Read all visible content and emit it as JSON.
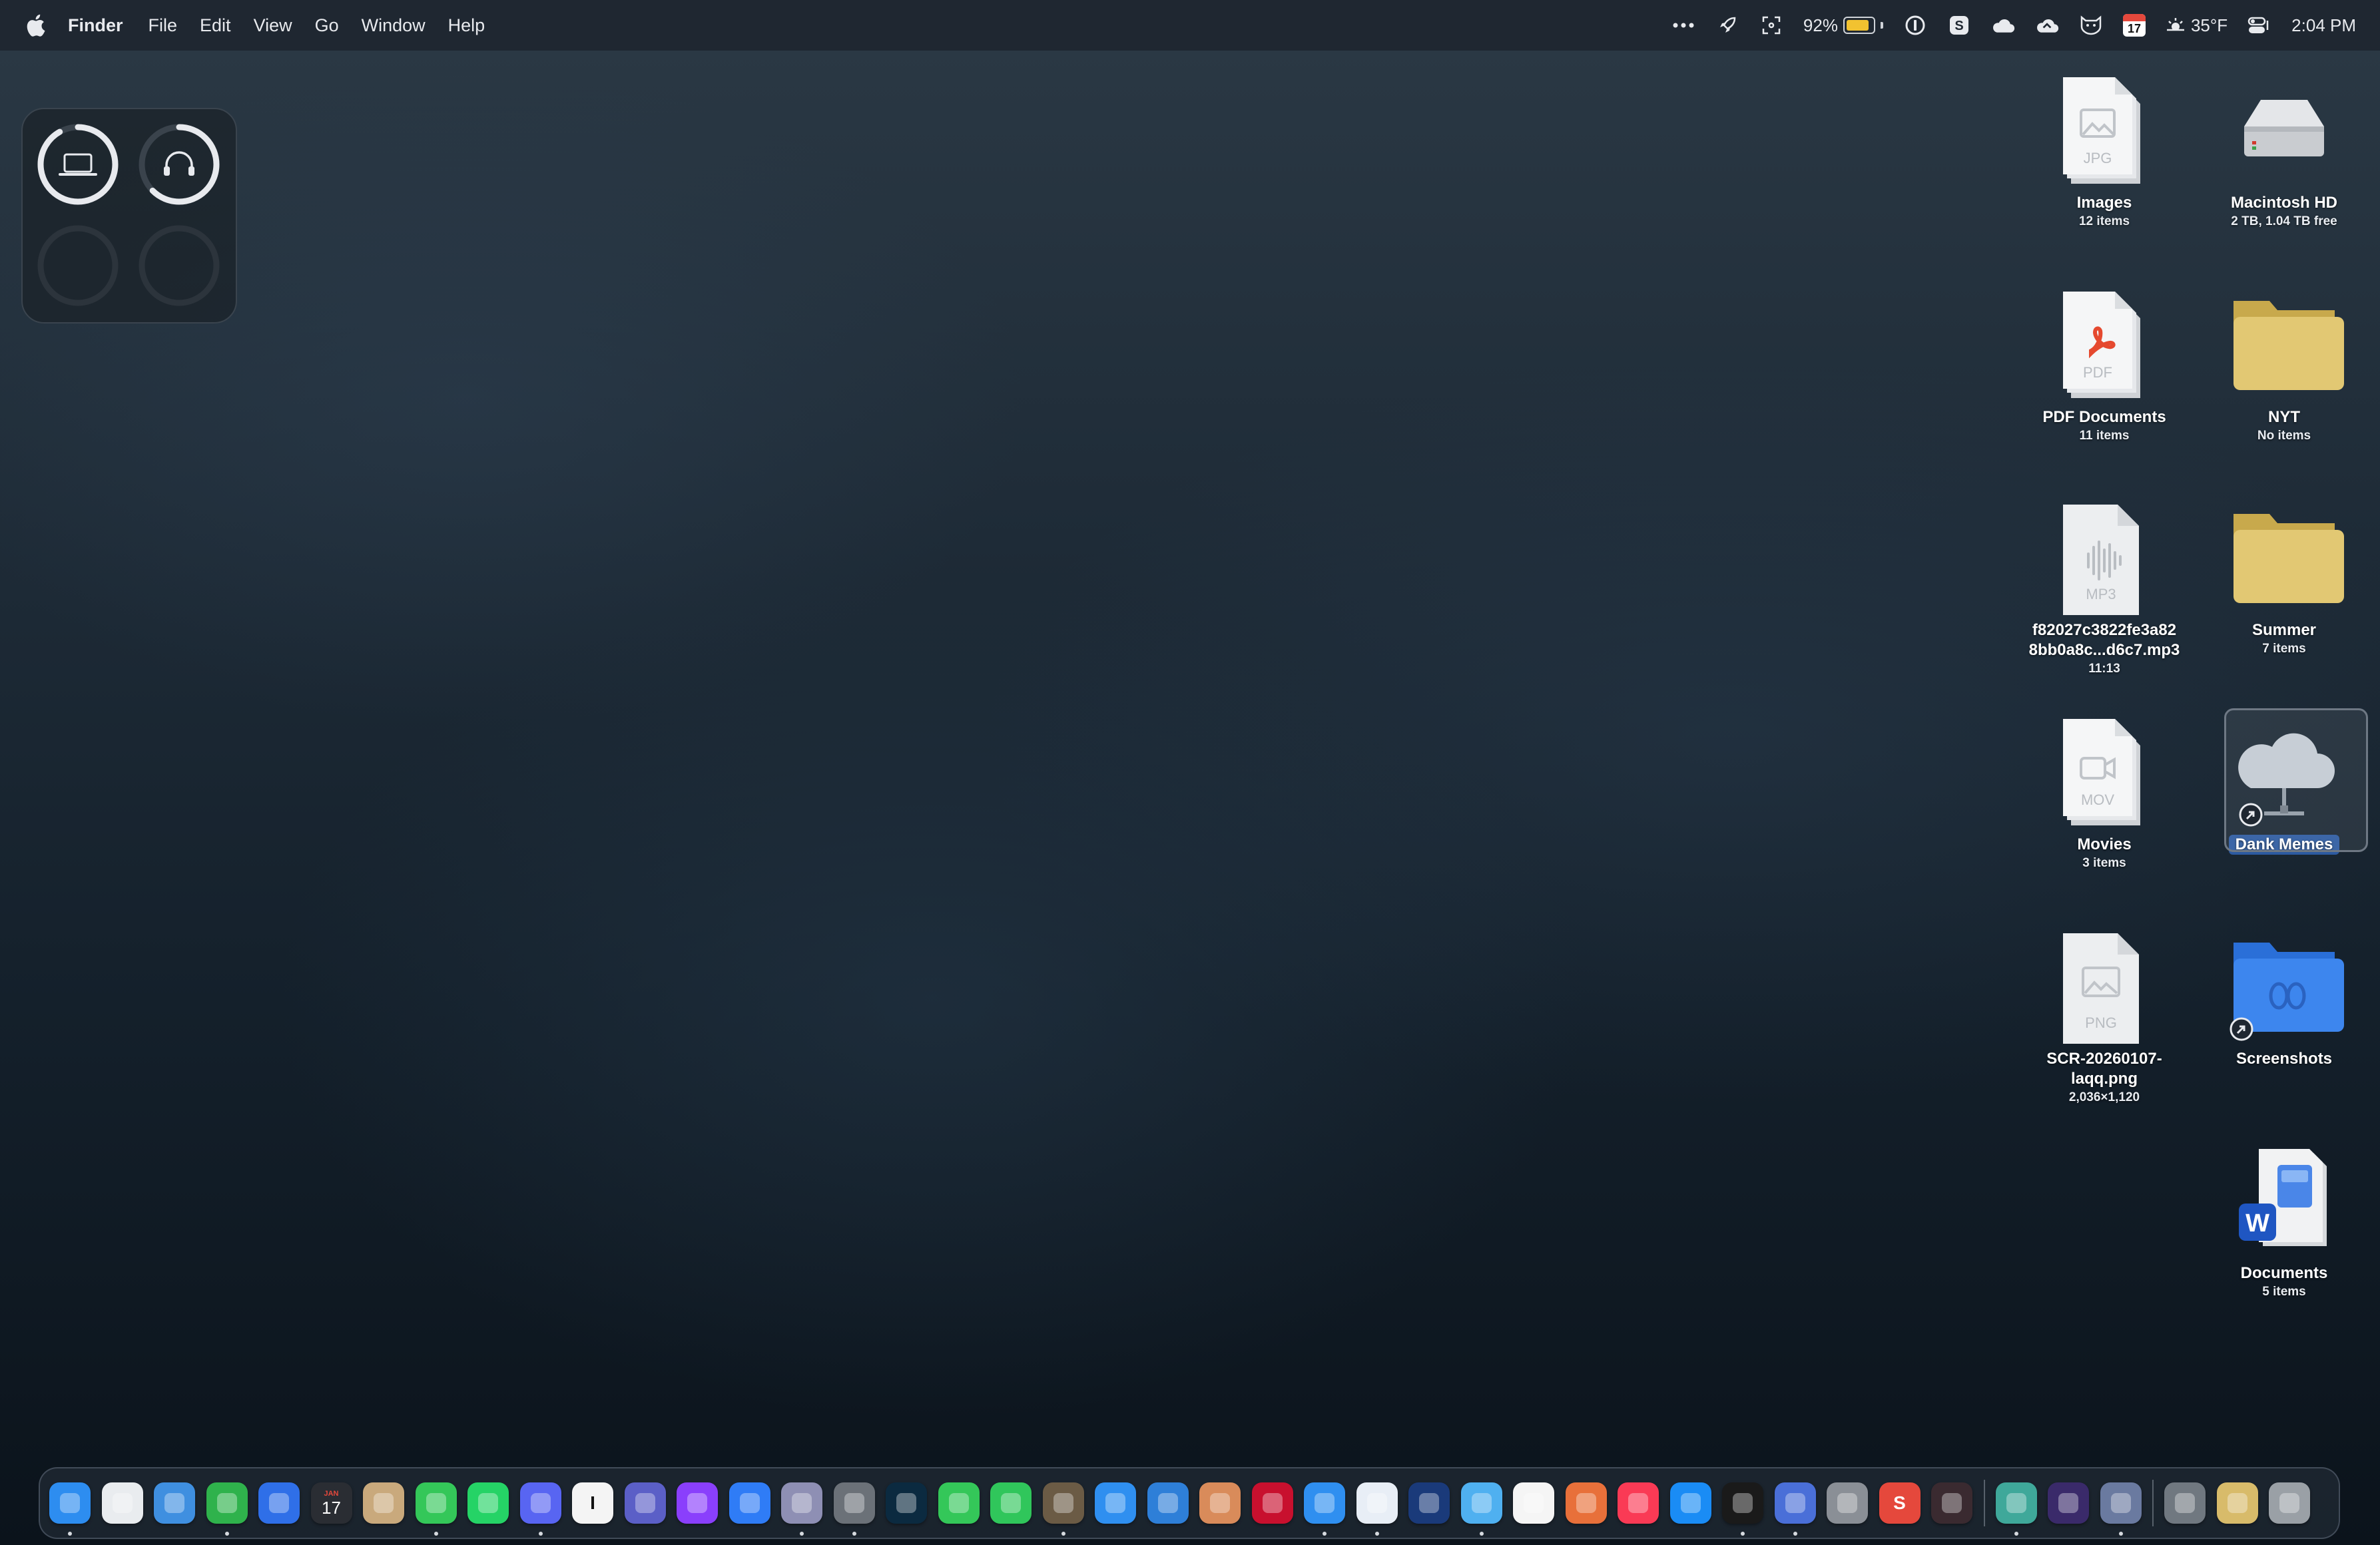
{
  "menubar": {
    "app_name": "Finder",
    "menus": [
      "File",
      "Edit",
      "View",
      "Go",
      "Window",
      "Help"
    ],
    "battery_percent": "92%",
    "battery_level": 0.92,
    "calendar_icon_day": "17",
    "weather": "35°F",
    "time": "2:04 PM",
    "status_icons": [
      "more-icon",
      "rocket-icon",
      "fullscreen-icon",
      "battery-icon",
      "1password-icon",
      "s-app-icon",
      "cloud-icon",
      "cloud-sync-icon",
      "shield-cat-icon",
      "calendar-icon",
      "weather-sun-icon",
      "control-center-icon"
    ]
  },
  "widget": {
    "name": "Batteries",
    "devices": [
      "laptop-icon",
      "headphones-icon"
    ]
  },
  "desktop_icons": {
    "images": {
      "label": "Images",
      "sub": "12 items",
      "badge": "JPG"
    },
    "macintosh_hd": {
      "label": "Macintosh HD",
      "sub": "2 TB, 1.04 TB free"
    },
    "pdf_documents": {
      "label": "PDF Documents",
      "sub": "11 items",
      "badge": "PDF"
    },
    "nyt": {
      "label": "NYT",
      "sub": "No items"
    },
    "mp3_file": {
      "label_line1": "f82027c3822fe3a82",
      "label_line2": "8bb0a8c...d6c7.mp3",
      "sub": "11:13",
      "badge": "MP3"
    },
    "summer": {
      "label": "Summer",
      "sub": "7 items"
    },
    "movies": {
      "label": "Movies",
      "sub": "3 items",
      "badge": "MOV"
    },
    "dank_memes": {
      "label": "Dank Memes"
    },
    "screenshot_file": {
      "label_line1": "SCR-20260107-",
      "label_line2": "laqq.png",
      "sub": "2,036×1,120",
      "badge": "PNG"
    },
    "screenshots": {
      "label": "Screenshots"
    },
    "documents": {
      "label": "Documents",
      "sub": "5 items"
    }
  },
  "dock": {
    "calendar_month": "JAN",
    "calendar_day": "17",
    "apps": [
      {
        "name": "finder",
        "color": "#2d8df0",
        "glyph": "",
        "running": true
      },
      {
        "name": "launchpad",
        "color": "#e9ecef",
        "glyph": "",
        "running": false
      },
      {
        "name": "weather",
        "color": "#3f8fe0",
        "glyph": "",
        "running": false
      },
      {
        "name": "evernote",
        "color": "#2fb24c",
        "glyph": "",
        "running": true
      },
      {
        "name": "spark",
        "color": "#2f6fe8",
        "glyph": "",
        "running": false
      },
      {
        "name": "calendar",
        "color": "#2a2d33",
        "glyph": "",
        "running": false
      },
      {
        "name": "contacts",
        "color": "#c9a97c",
        "glyph": "",
        "running": false
      },
      {
        "name": "messages",
        "color": "#34c759",
        "glyph": "",
        "running": true
      },
      {
        "name": "whatsapp",
        "color": "#25d366",
        "glyph": "",
        "running": false
      },
      {
        "name": "discord",
        "color": "#5865f2",
        "glyph": "",
        "running": true
      },
      {
        "name": "instapaper",
        "color": "#f4f4f4",
        "glyph": "I",
        "running": false
      },
      {
        "name": "teams",
        "color": "#5b5fc7",
        "glyph": "",
        "running": false
      },
      {
        "name": "notes-app",
        "color": "#8a3ffc",
        "glyph": "",
        "running": false
      },
      {
        "name": "things",
        "color": "#2f7cf6",
        "glyph": "",
        "running": false
      },
      {
        "name": "tableplus",
        "color": "#8e8fb4",
        "glyph": "",
        "running": true
      },
      {
        "name": "slack",
        "color": "#6b7178",
        "glyph": "",
        "running": true
      },
      {
        "name": "webex",
        "color": "#0b2a40",
        "glyph": "",
        "running": false
      },
      {
        "name": "phone",
        "color": "#34c759",
        "glyph": "",
        "running": false
      },
      {
        "name": "facetime",
        "color": "#30c65b",
        "glyph": "",
        "running": false
      },
      {
        "name": "affinity",
        "color": "#6b5b45",
        "glyph": "",
        "running": true
      },
      {
        "name": "safari",
        "color": "#2f8ff0",
        "glyph": "",
        "running": false
      },
      {
        "name": "windows-app",
        "color": "#2e7fd8",
        "glyph": "",
        "running": false
      },
      {
        "name": "package",
        "color": "#d98b5a",
        "glyph": "",
        "running": false
      },
      {
        "name": "acrobat",
        "color": "#c8102e",
        "glyph": "",
        "running": false
      },
      {
        "name": "bookmark",
        "color": "#2f8ff0",
        "glyph": "",
        "running": true
      },
      {
        "name": "instapaper-blue",
        "color": "#e8eef6",
        "glyph": "",
        "running": true
      },
      {
        "name": "teamviewer",
        "color": "#1a3a7a",
        "glyph": "",
        "running": false
      },
      {
        "name": "maps",
        "color": "#4fb0f0",
        "glyph": "",
        "running": true
      },
      {
        "name": "photos",
        "color": "#f5f5f5",
        "glyph": "",
        "running": false
      },
      {
        "name": "pixelmator",
        "color": "#e8703a",
        "glyph": "",
        "running": false
      },
      {
        "name": "music",
        "color": "#fa3a55",
        "glyph": "",
        "running": false
      },
      {
        "name": "app-store",
        "color": "#1a8cf5",
        "glyph": "",
        "running": false
      },
      {
        "name": "chatgpt",
        "color": "#1a1a1a",
        "glyph": "",
        "running": true
      },
      {
        "name": "ipad-app",
        "color": "#4a6fd8",
        "glyph": "",
        "running": true
      },
      {
        "name": "system-settings",
        "color": "#8a8f96",
        "glyph": "",
        "running": false
      },
      {
        "name": "scrivener",
        "color": "#e5483c",
        "glyph": "S",
        "running": false
      },
      {
        "name": "affinity-pub",
        "color": "#3a2a30",
        "glyph": "",
        "running": false
      }
    ],
    "apps_right": [
      {
        "name": "link-tool",
        "color": "#3fa89a",
        "glyph": "",
        "running": true
      },
      {
        "name": "obsidian",
        "color": "#3a2a6a",
        "glyph": "",
        "running": false
      },
      {
        "name": "disk-utility",
        "color": "#6a7aa0",
        "glyph": "",
        "running": true
      }
    ],
    "apps_trailing": [
      {
        "name": "network-share",
        "color": "#707880",
        "glyph": "",
        "running": false
      },
      {
        "name": "downloads-folder",
        "color": "#d8bb6a",
        "glyph": "",
        "running": false
      },
      {
        "name": "trash",
        "color": "#9aa0a6",
        "glyph": "",
        "running": false
      }
    ]
  }
}
